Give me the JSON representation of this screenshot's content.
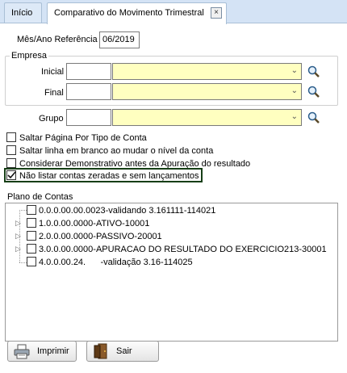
{
  "tabs": [
    {
      "label": "Início"
    },
    {
      "label": "Comparativo do Movimento Trimestral",
      "close": "×"
    }
  ],
  "form": {
    "ref_label": "Mês/Ano Referência",
    "ref_value": "06/2019",
    "empresa_label": "Empresa",
    "inicial_label": "Inicial",
    "final_label": "Final",
    "grupo_label": "Grupo"
  },
  "options": [
    {
      "label": "Saltar Página Por Tipo de Conta",
      "checked": false
    },
    {
      "label": "Saltar linha em branco ao mudar o nível da conta",
      "checked": false
    },
    {
      "label": "Considerar Demonstrativo antes da Apuração do resultado",
      "checked": false
    },
    {
      "label": "Não listar contas zeradas e sem lançamentos",
      "checked": true
    }
  ],
  "plano": {
    "title": "Plano de Contas",
    "nodes": [
      {
        "label": "0.0.0.00.00.0023-validando 3.161111-114021",
        "expandable": false
      },
      {
        "label": "1.0.0.00.0000-ATIVO-10001",
        "expandable": true
      },
      {
        "label": "2.0.0.00.0000-PASSIVO-20001",
        "expandable": true
      },
      {
        "label": "3.0.0.00.0000-APURACAO DO RESULTADO DO EXERCICIO213-30001",
        "expandable": true
      },
      {
        "label": "4.0.0.00.24.      -validação 3.16-114025",
        "expandable": false
      }
    ]
  },
  "buttons": {
    "print": "Imprimir",
    "exit": "Sair"
  },
  "colors": {
    "combo_bg": "#ffffc0",
    "highlight_border": "#163e16",
    "tab_bg": "#d4e3f5"
  }
}
